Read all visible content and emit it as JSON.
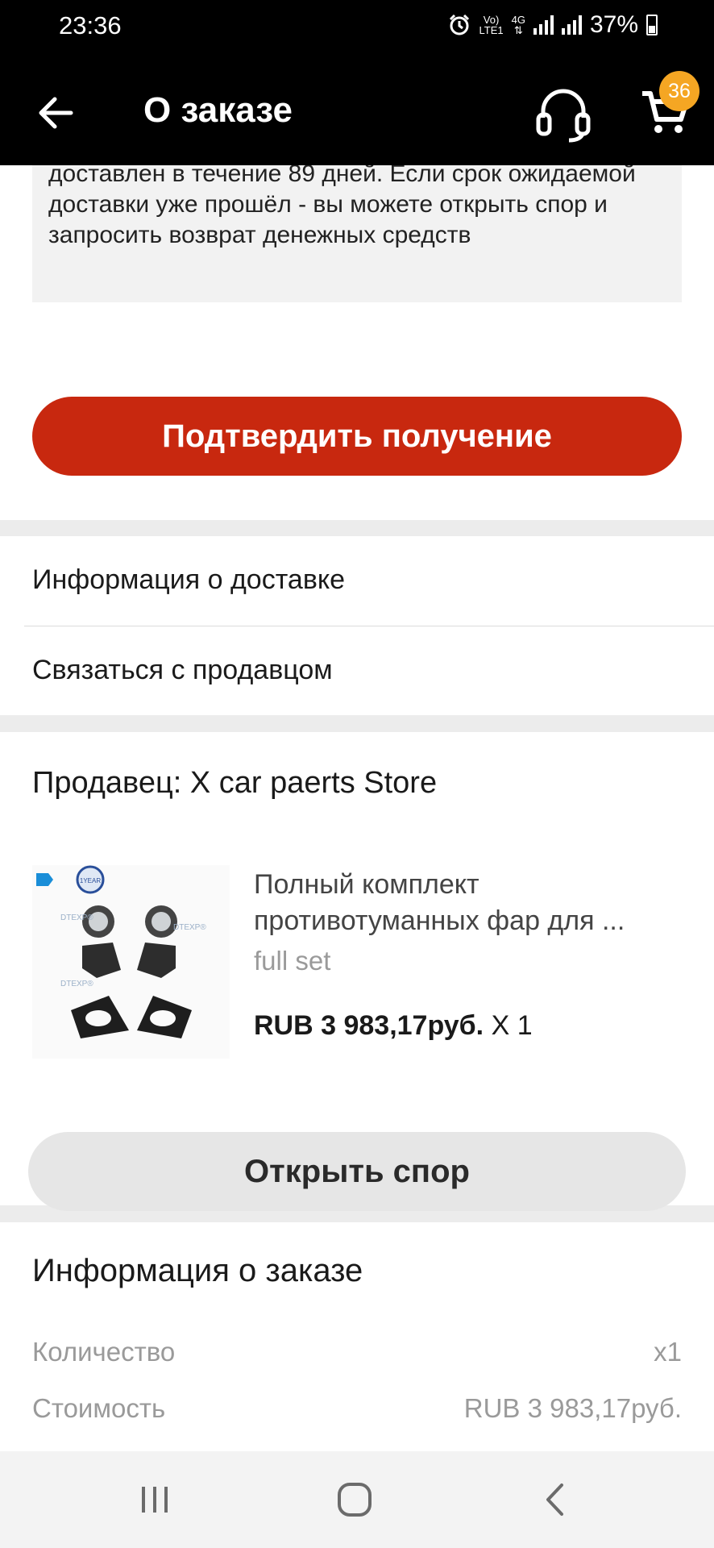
{
  "status_bar": {
    "time": "23:36",
    "net_top": "Vo)",
    "net_bottom": "LTE1",
    "net_type": "4G",
    "battery": "37%"
  },
  "app_bar": {
    "title": "О заказе",
    "cart_count": "36",
    "accent": "#f5a623"
  },
  "notice": {
    "text": "доставлен в течение 89 дней. Если срок ожидаемой доставки уже прошёл - вы можете открыть спор и запросить возврат денежных средств"
  },
  "confirm_button": {
    "label": "Подтвердить получение",
    "color": "#c8280f"
  },
  "links": {
    "delivery_info": "Информация о доставке",
    "contact_seller": "Связаться с продавцом"
  },
  "seller": {
    "title": "Продавец: X car paerts Store",
    "product": {
      "name": "Полный комплект противотуманных фар для ...",
      "variant": "full set",
      "price": "RUB 3 983,17руб.",
      "quantity": "X 1",
      "image_watermark": "DTEXP®"
    },
    "dispute_button": "Открыть спор"
  },
  "order_info": {
    "title": "Информация о заказе",
    "rows": [
      {
        "label": "Количество",
        "value": "x1"
      },
      {
        "label": "Стоимость",
        "value": "RUB 3 983,17руб."
      }
    ]
  },
  "icons": {
    "back": "arrow-left-icon",
    "support": "headset-icon",
    "cart": "cart-icon",
    "nav_recents": "recents-icon",
    "nav_home": "home-icon",
    "nav_back": "chevron-left-icon"
  }
}
